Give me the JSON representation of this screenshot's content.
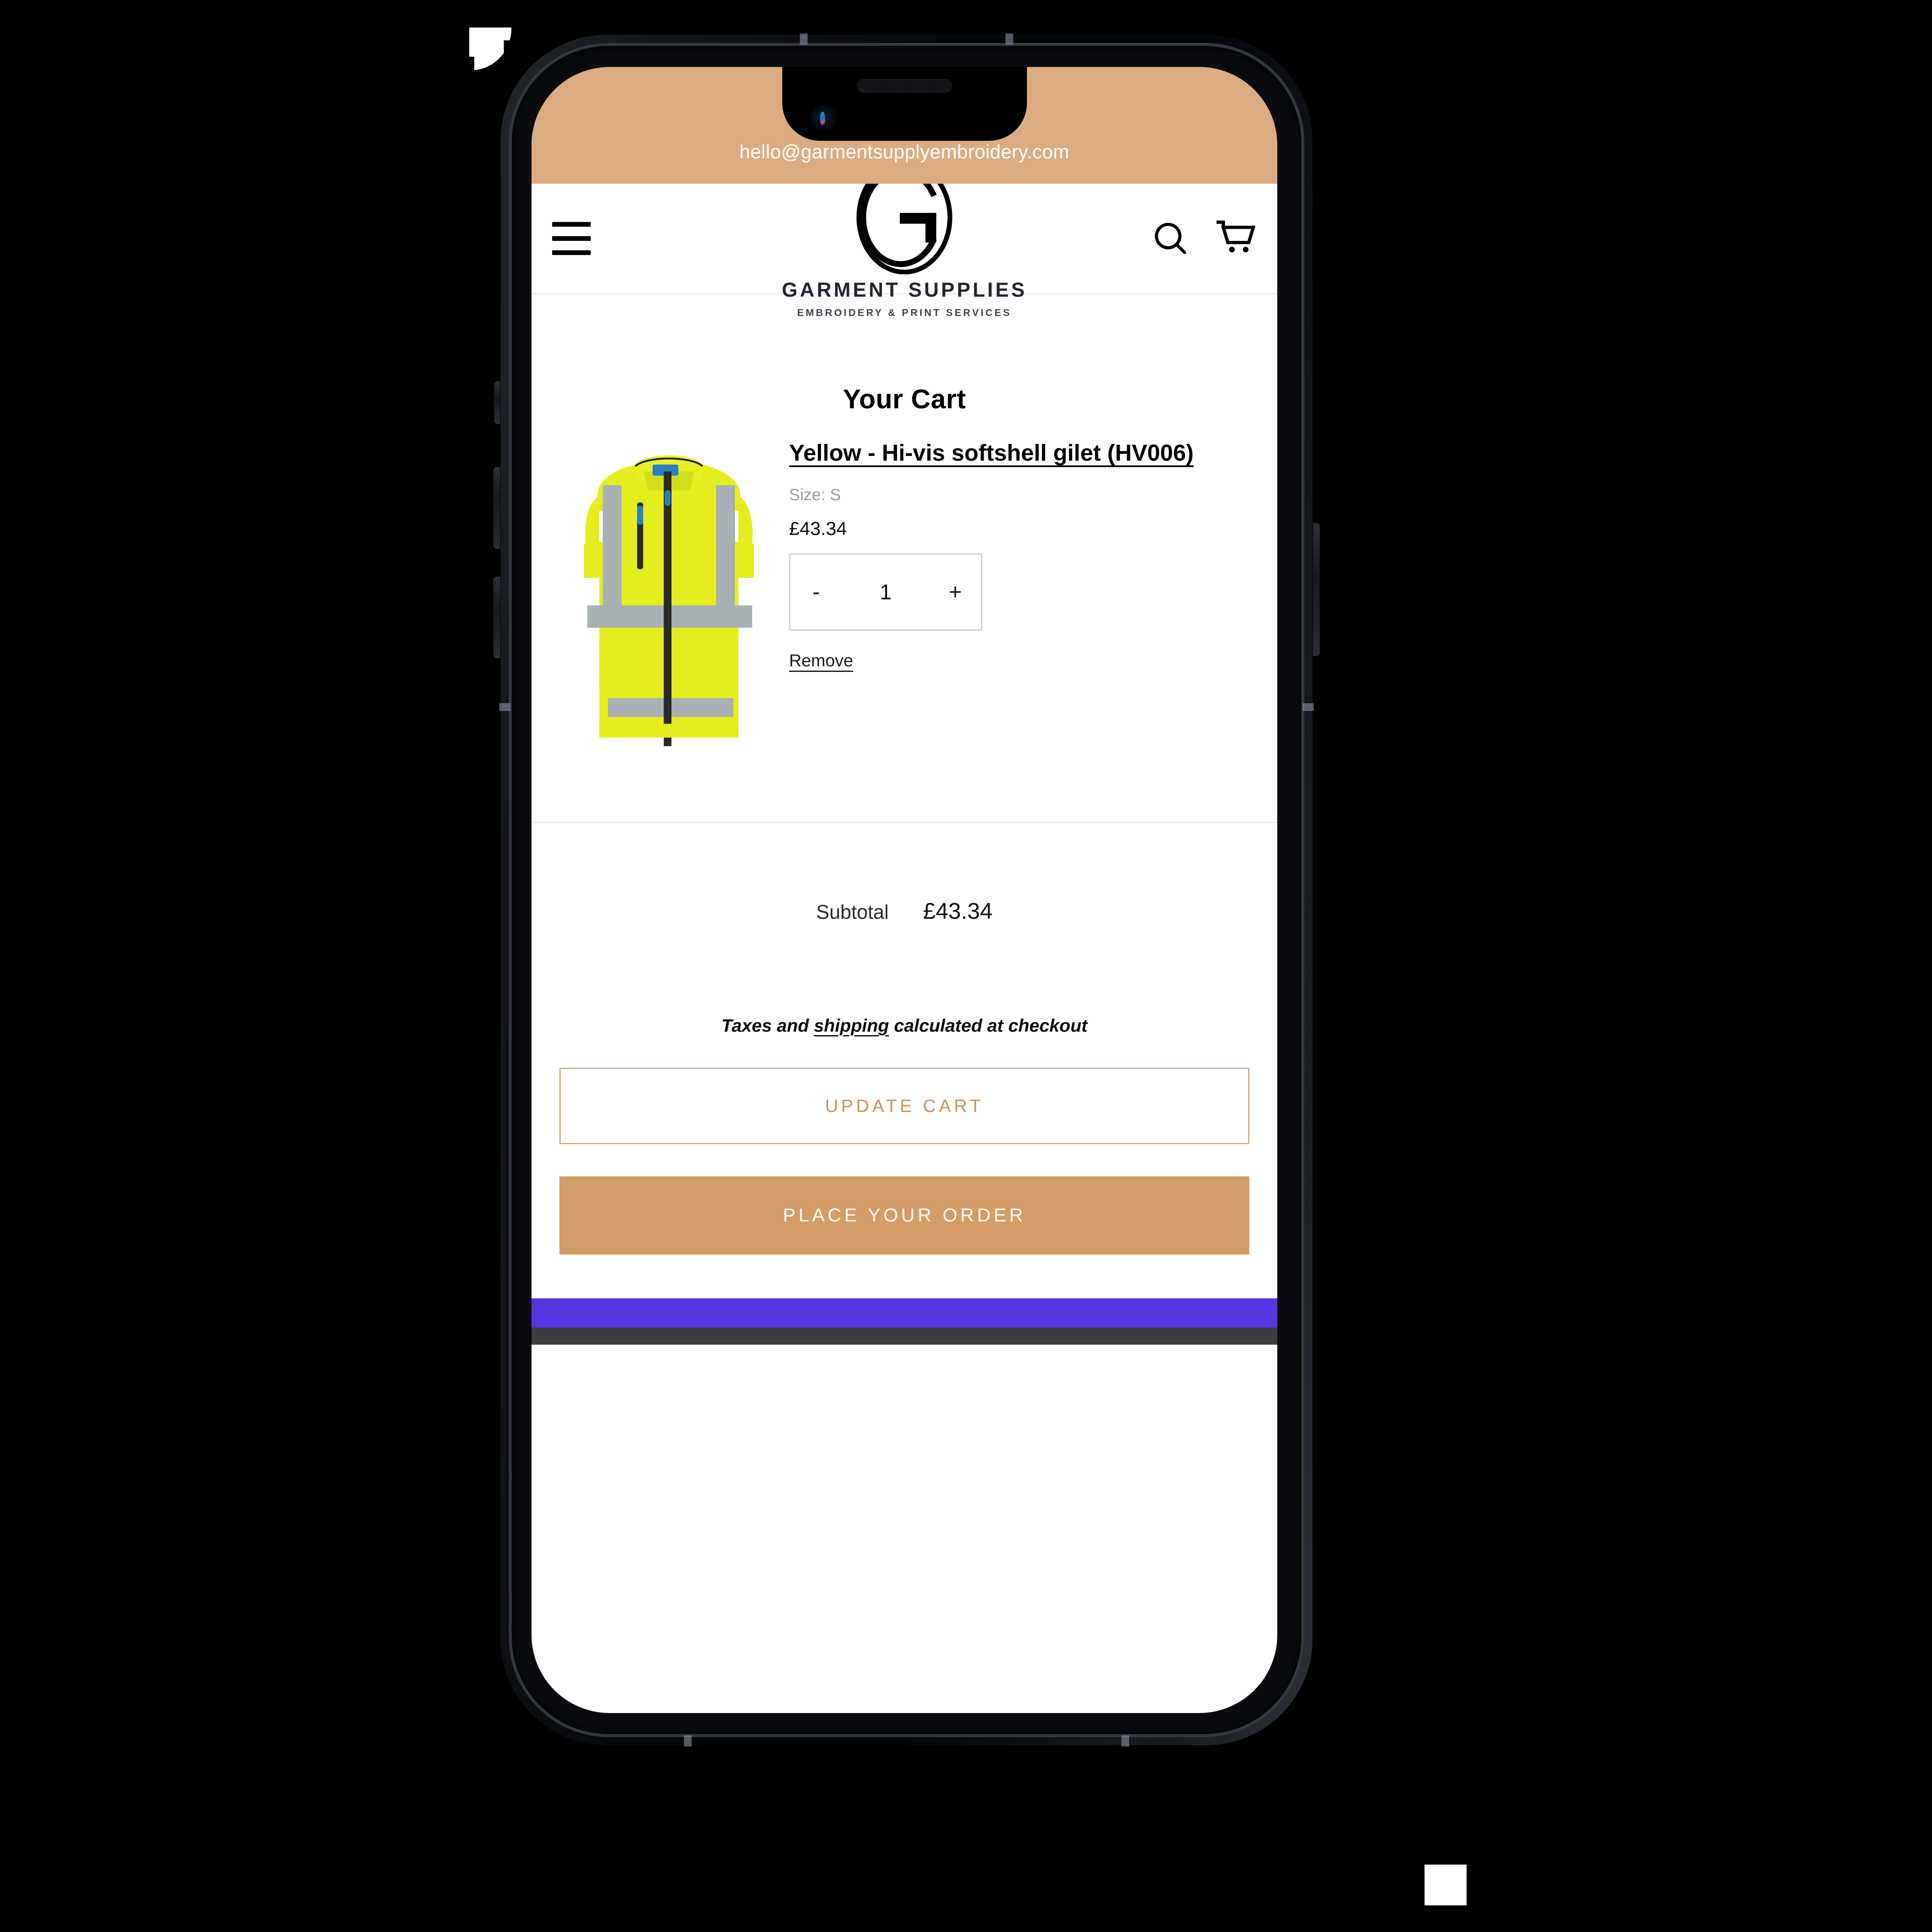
{
  "announcement": {
    "email": "hello@garmentsupplyembroidery.com"
  },
  "header": {
    "menu_icon": "hamburger-menu-icon",
    "search_icon": "search-icon",
    "cart_icon": "shopping-cart-icon",
    "logo": {
      "mark": "letter-g-monogram",
      "name": "GARMENT SUPPLIES",
      "tagline": "EMBROIDERY & PRINT SERVICES"
    }
  },
  "cart": {
    "title": "Your Cart",
    "items": [
      {
        "image_alt": "yellow-hi-vis-softshell-gilet",
        "title": "Yellow - Hi-vis softshell gilet (HV006)",
        "variant": "Size: S",
        "price": "£43.34",
        "quantity": "1",
        "decrement_label": "-",
        "increment_label": "+",
        "remove_label": "Remove"
      }
    ],
    "subtotal_label": "Subtotal",
    "subtotal_value": "£43.34",
    "tax_note_prefix": "Taxes and ",
    "tax_note_link": "shipping",
    "tax_note_suffix": " calculated at checkout",
    "update_button": "UPDATE CART",
    "checkout_button": "PLACE YOUR ORDER"
  },
  "colors": {
    "brand_tan": "#dbac82",
    "button_tan": "#d49c66",
    "button_outline": "#dfa878",
    "button_text_tan": "#d08f56",
    "bottom_bar_purple": "#5636e0",
    "divider": "#eceded",
    "muted_text": "#9a9a9a"
  }
}
